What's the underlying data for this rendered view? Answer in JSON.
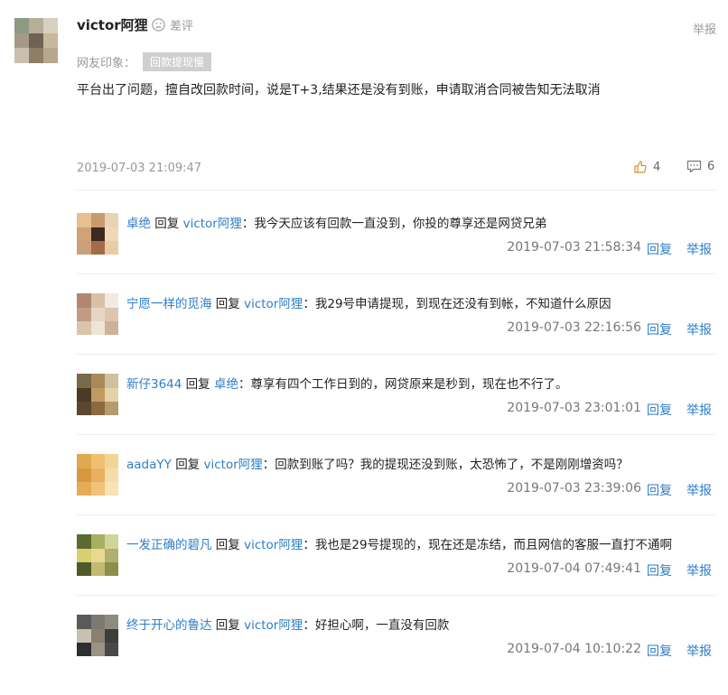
{
  "post": {
    "username": "victor阿狸",
    "rating_label": "差评",
    "report_label": "举报",
    "impression_label": "网友印象：",
    "impression_tag": "回款提现慢",
    "content": "平台出了问题，擅自改回款时间，说是T+3,结果还是没有到账，申请取消合同被告知无法取消",
    "time": "2019-07-03 21:09:47",
    "likes": "4",
    "comments": "6"
  },
  "replies": [
    {
      "author": "卓绝",
      "reply_word": "回复",
      "target": "victor阿狸",
      "text": "：我今天应该有回款一直没到，你投的尊享还是网贷兄弟",
      "time": "2019-07-03 21:58:34",
      "reply_label": "回复",
      "report_label": "举报"
    },
    {
      "author": "宁愿一样的觅海",
      "reply_word": "回复",
      "target": "victor阿狸",
      "text": "：我29号申请提现，到现在还没有到帐，不知道什么原因",
      "time": "2019-07-03 22:16:56",
      "reply_label": "回复",
      "report_label": "举报"
    },
    {
      "author": "新仔3644",
      "reply_word": "回复",
      "target": "卓绝",
      "text": "：尊享有四个工作日到的，网贷原来是秒到，现在也不行了。",
      "time": "2019-07-03 23:01:01",
      "reply_label": "回复",
      "report_label": "举报"
    },
    {
      "author": "aadaYY",
      "reply_word": "回复",
      "target": "victor阿狸",
      "text": "：回款到账了吗？我的提现还没到账，太恐怖了，不是刚刚增资吗？",
      "time": "2019-07-03 23:39:06",
      "reply_label": "回复",
      "report_label": "举报"
    },
    {
      "author": "一发正确的碧凡",
      "reply_word": "回复",
      "target": "victor阿狸",
      "text": "：我也是29号提现的，现在还是冻结，而且网信的客服一直打不通啊",
      "time": "2019-07-04 07:49:41",
      "reply_label": "回复",
      "report_label": "举报"
    },
    {
      "author": "终于开心的鲁达",
      "reply_word": "回复",
      "target": "victor阿狸",
      "text": "：好担心啊，一直没有回款",
      "time": "2019-07-04 10:10:22",
      "reply_label": "回复",
      "report_label": "举报"
    }
  ]
}
